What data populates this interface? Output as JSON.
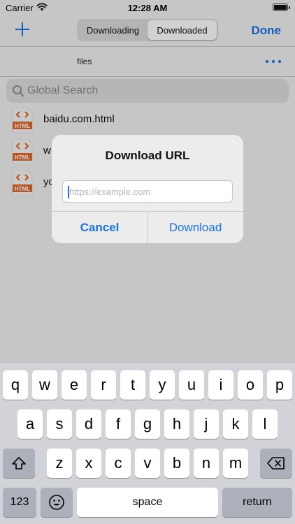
{
  "status_bar": {
    "carrier": "Carrier",
    "time": "12:28 AM",
    "wifi_icon": "wifi-icon",
    "battery_icon": "battery-icon"
  },
  "nav": {
    "add_icon": "plus-icon",
    "tabs": [
      {
        "label": "Downloading",
        "active": false
      },
      {
        "label": "Downloaded",
        "active": true
      }
    ],
    "done_label": "Done"
  },
  "path": {
    "label": "files",
    "more_icon": "ellipsis-icon"
  },
  "search": {
    "placeholder": "Global Search"
  },
  "files": [
    {
      "name": "baidu.com.html",
      "icon": "html-file-icon"
    },
    {
      "name": "w",
      "icon": "html-file-icon"
    },
    {
      "name": "yo",
      "icon": "html-file-icon"
    }
  ],
  "dialog": {
    "title": "Download URL",
    "input_placeholder": "https://example.com",
    "input_value": "",
    "cancel_label": "Cancel",
    "confirm_label": "Download"
  },
  "keyboard": {
    "row1": [
      "q",
      "w",
      "e",
      "r",
      "t",
      "y",
      "u",
      "i",
      "o",
      "p"
    ],
    "row2": [
      "a",
      "s",
      "d",
      "f",
      "g",
      "h",
      "j",
      "k",
      "l"
    ],
    "row3": [
      "z",
      "x",
      "c",
      "v",
      "b",
      "n",
      "m"
    ],
    "numbers_label": "123",
    "space_label": "space",
    "return_label": "return"
  },
  "colors": {
    "accent": "#1a73e8",
    "html_icon": "#e06a2c"
  }
}
